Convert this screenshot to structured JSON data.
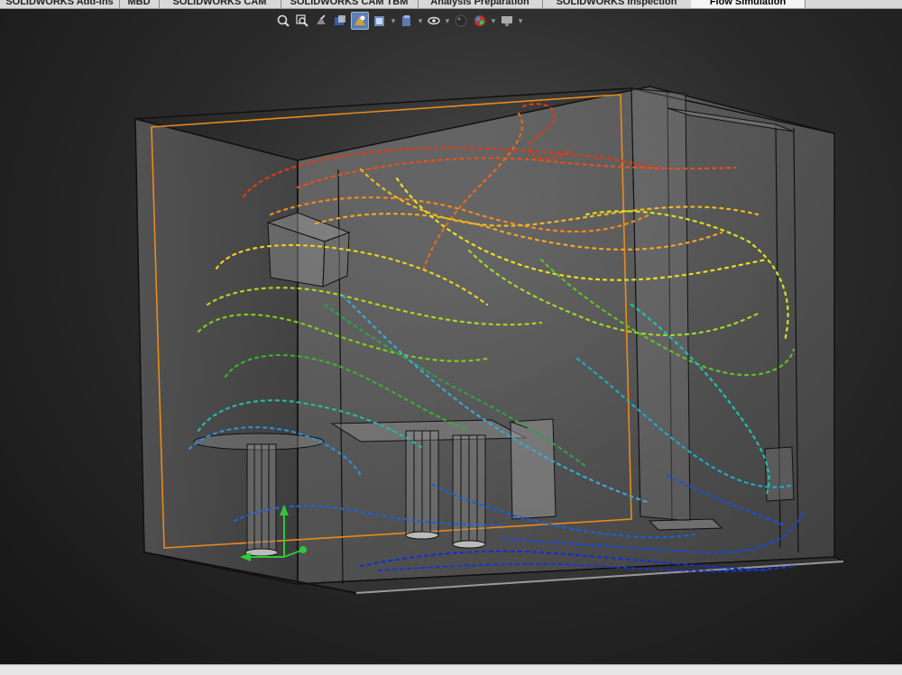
{
  "tabs": [
    {
      "label": "SOLIDWORKS Add-Ins",
      "active": false
    },
    {
      "label": "MBD",
      "active": false
    },
    {
      "label": "SOLIDWORKS CAM",
      "active": false
    },
    {
      "label": "SOLIDWORKS CAM TBM",
      "active": false
    },
    {
      "label": "Analysis Preparation",
      "active": false
    },
    {
      "label": "SOLIDWORKS Inspection",
      "active": false
    },
    {
      "label": "Flow Simulation",
      "active": true
    }
  ],
  "toolbar": [
    {
      "icon": "zoom-to-fit-icon"
    },
    {
      "icon": "zoom-to-area-icon"
    },
    {
      "icon": "previous-view-icon"
    },
    {
      "icon": "section-view-icon"
    },
    {
      "icon": "dynamic-annotation-icon",
      "active": true
    },
    {
      "icon": "view-orientation-icon",
      "dropdown": true
    },
    {
      "icon": "display-style-icon",
      "dropdown": true
    },
    {
      "icon": "hide-show-items-icon",
      "dropdown": true
    },
    {
      "icon": "edit-appearance-icon"
    },
    {
      "icon": "apply-scene-icon",
      "dropdown": true
    },
    {
      "icon": "view-settings-icon",
      "dropdown": true
    }
  ],
  "colors": {
    "enclosure_outline": "#e88a1e",
    "flow_high": "#e03a10",
    "flow_low": "#1030d0"
  }
}
